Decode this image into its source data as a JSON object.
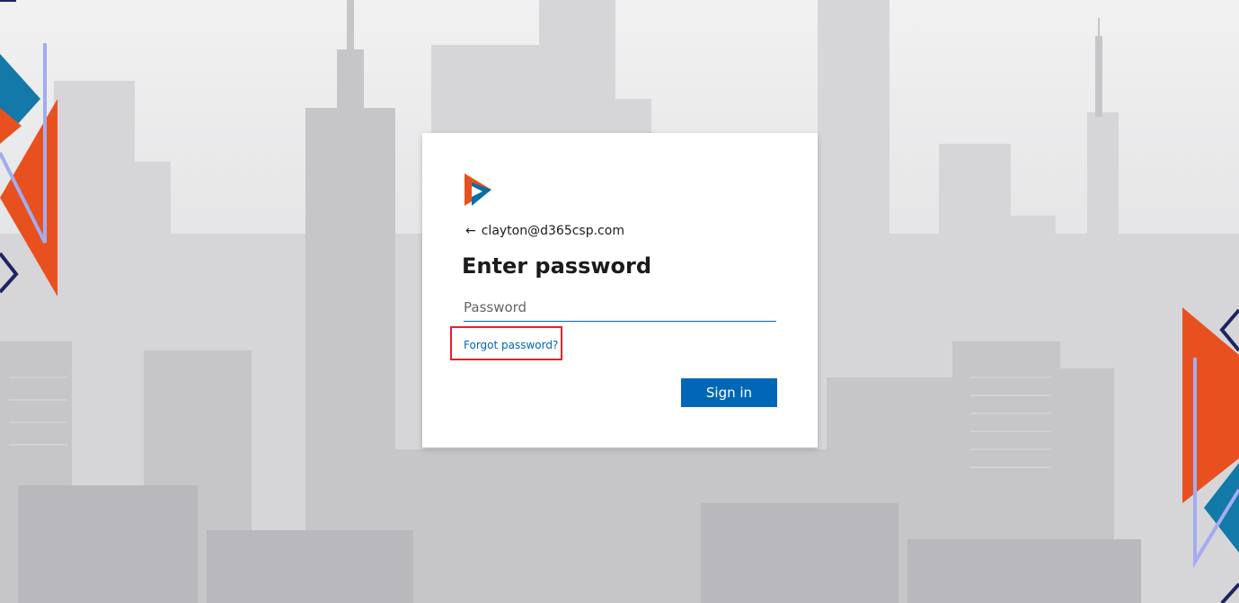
{
  "identity": {
    "back_arrow": "←",
    "email": "clayton@d365csp.com"
  },
  "title": "Enter password",
  "password": {
    "placeholder": "Password",
    "value": ""
  },
  "forgot_link": "Forgot password?",
  "signin_button": "Sign in",
  "colors": {
    "accent": "#0067b8",
    "highlight_border": "#e0252b",
    "logo_orange": "#e8511f",
    "logo_blue": "#0b6fa3",
    "deco_orange": "#e8511f",
    "deco_teal": "#1279a8",
    "deco_lavender": "#a4abef",
    "deco_navy": "#1f2460"
  },
  "icons": {
    "logo": "brand-play-logo-icon",
    "back": "back-arrow-icon"
  }
}
